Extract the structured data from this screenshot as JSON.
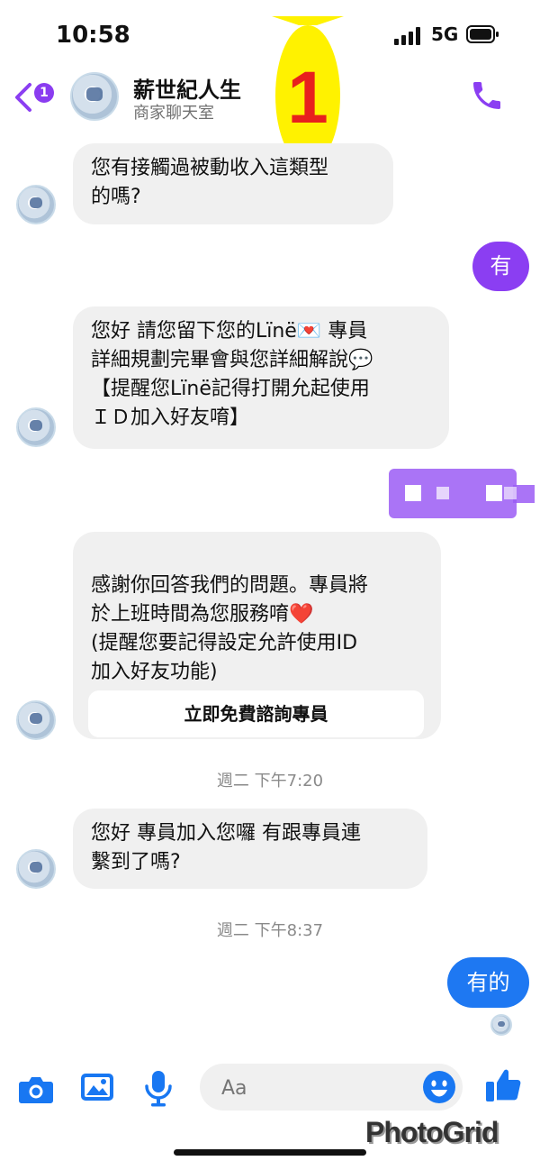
{
  "status_bar": {
    "time": "10:58",
    "network": "5G"
  },
  "header": {
    "back_badge": "1",
    "title": "薪世紀人生",
    "subtitle": "商家聊天室",
    "overlay_number": "1"
  },
  "messages": {
    "m1": "您有接觸過被動收入這類型\n的嗎?",
    "reply1": "有",
    "m2": "您好  請您留下您的Lïnë💌 專員\n詳細規劃完畢會與您詳細解說💬\n【提醒您Lïnë記得打開允起使用\nＩＤ加入好友唷】",
    "m3": "感謝你回答我們的問題。專員將\n於上班時間為您服務唷❤️\n(提醒您要記得設定允許使用ID\n加入好友功能)",
    "m3_button": "立即免費諮詢專員",
    "ts1": "週二 下午7:20",
    "m4": "您好 專員加入您囉 有跟專員連\n繫到了嗎?",
    "ts2": "週二 下午8:37",
    "reply2": "有的"
  },
  "composer": {
    "placeholder": "Aa"
  },
  "watermark": "PhotoGrid",
  "colors": {
    "accent_purple": "#8b3ef2",
    "sent_blue": "#1e78f2",
    "icon_blue": "#1877f2",
    "bubble_gray": "#f0f0f0"
  }
}
